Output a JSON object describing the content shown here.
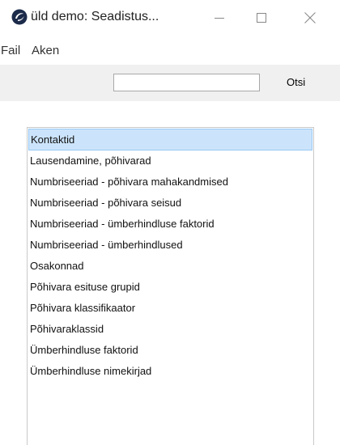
{
  "window": {
    "title": "üld demo: Seadistus...",
    "icon": "app-logo-icon",
    "controls": [
      "minimize-icon",
      "maximize-icon",
      "close-icon"
    ]
  },
  "menu": {
    "file": "Fail",
    "window": "Aken"
  },
  "toolbar": {
    "search_value": "",
    "search_button_label": "Otsi"
  },
  "list": {
    "selected_index": 0,
    "items": [
      "Kontaktid",
      "Lausendamine, põhivarad",
      "Numbriseeriad - põhivara mahakandmised",
      "Numbriseeriad - põhivara seisud",
      "Numbriseeriad - ümberhindluse faktorid",
      "Numbriseeriad - ümberhindlused",
      "Osakonnad",
      "Põhivara esituse grupid",
      "Põhivara klassifikaator",
      "Põhivaraklassid",
      "Ümberhindluse faktorid",
      "Ümberhindluse nimekirjad"
    ]
  },
  "colors": {
    "selection_bg": "#cce4fb",
    "selection_border": "#99c9f4",
    "toolbar_bg": "#f0f0f0"
  }
}
